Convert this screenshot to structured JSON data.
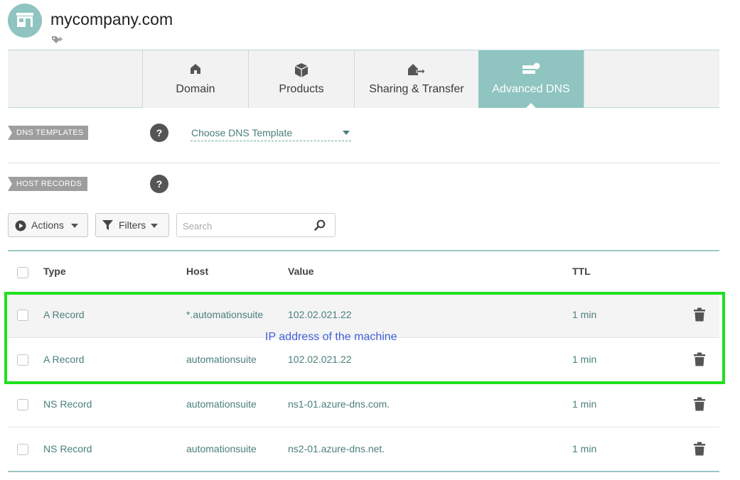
{
  "header": {
    "domain": "mycompany.com",
    "avatar_icon": "store-icon",
    "tag_icon": "tag-add-icon"
  },
  "tabs": [
    {
      "label": "Domain",
      "icon": "home-icon",
      "active": false
    },
    {
      "label": "Products",
      "icon": "box-icon",
      "active": false
    },
    {
      "label": "Sharing & Transfer",
      "icon": "house-transfer-icon",
      "active": false
    },
    {
      "label": "Advanced DNS",
      "icon": "server-icon",
      "active": true
    }
  ],
  "dns_templates": {
    "label": "DNS TEMPLATES",
    "help": "?",
    "select_value": "Choose DNS Template"
  },
  "host_records": {
    "label": "HOST RECORDS",
    "help": "?"
  },
  "toolbar": {
    "actions_label": "Actions",
    "filters_label": "Filters",
    "search_placeholder": "Search"
  },
  "table": {
    "columns": {
      "type": "Type",
      "host": "Host",
      "value": "Value",
      "ttl": "TTL"
    },
    "rows": [
      {
        "type": "A Record",
        "host": "*.automationsuite",
        "value": "102.02.021.22",
        "ttl": "1 min"
      },
      {
        "type": "A Record",
        "host": "automationsuite",
        "value": "102.02.021.22",
        "ttl": "1 min"
      },
      {
        "type": "NS Record",
        "host": "automationsuite",
        "value": "ns1-01.azure-dns.com.",
        "ttl": "1 min"
      },
      {
        "type": "NS Record",
        "host": "automationsuite",
        "value": "ns2-01.azure-dns.net.",
        "ttl": "1 min"
      }
    ]
  },
  "annotation": {
    "text": "IP address of the machine",
    "highlight_color": "#1ee11e"
  },
  "colors": {
    "accent": "#8fc4c0",
    "link": "#4a7f7b",
    "annotation_text": "#4060d8"
  }
}
